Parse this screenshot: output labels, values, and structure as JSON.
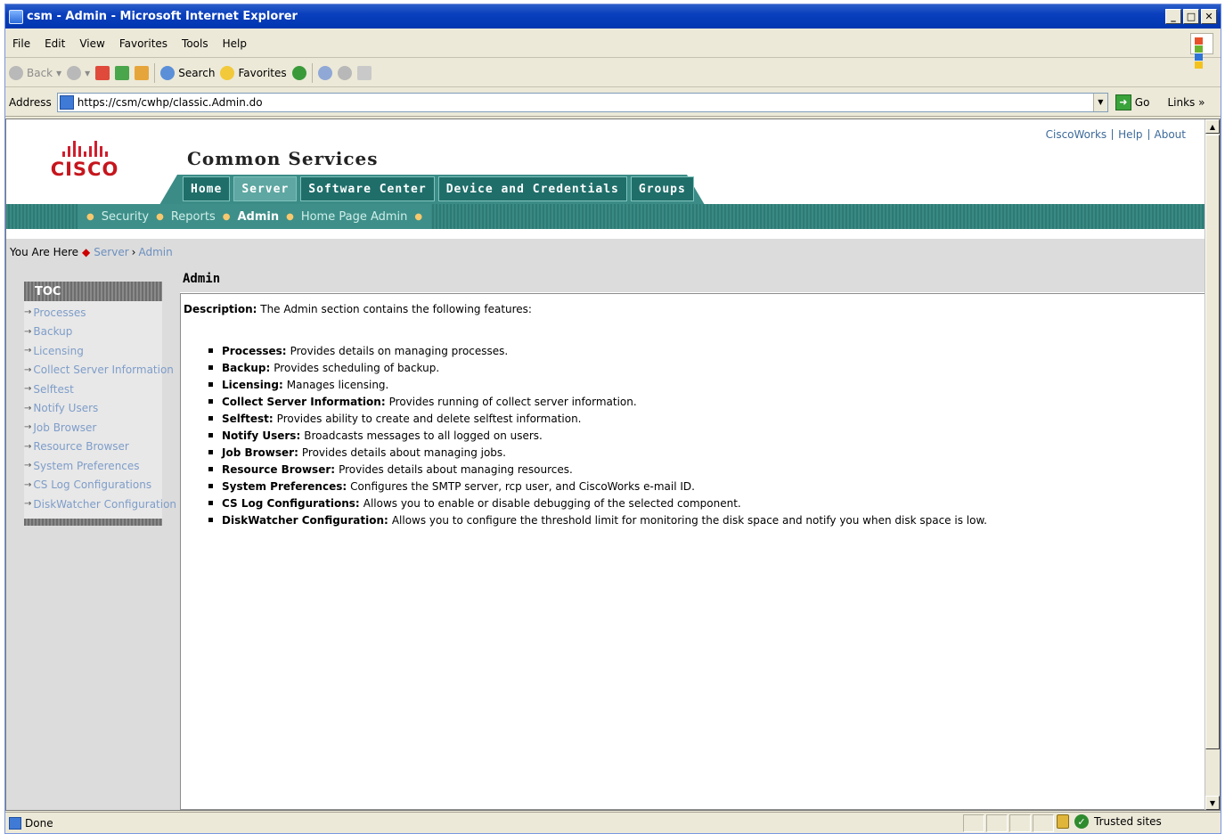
{
  "window": {
    "title": "csm - Admin - Microsoft Internet Explorer"
  },
  "menu": [
    "File",
    "Edit",
    "View",
    "Favorites",
    "Tools",
    "Help"
  ],
  "toolbar": {
    "back": "Back",
    "search": "Search",
    "favorites": "Favorites"
  },
  "address": {
    "label": "Address",
    "url": "https://csm/cwhp/classic.Admin.do",
    "go": "Go",
    "links": "Links"
  },
  "header": {
    "brand": "CISCO",
    "site_title": "Common Services",
    "top_links": [
      "CiscoWorks",
      "Help",
      "About"
    ],
    "tabs": [
      "Home",
      "Server",
      "Software Center",
      "Device and Credentials",
      "Groups"
    ],
    "active_tab": "Server",
    "subnav": [
      "Security",
      "Reports",
      "Admin",
      "Home Page Admin"
    ],
    "active_subnav": "Admin"
  },
  "breadcrumb": {
    "prefix": "You Are Here",
    "items": [
      "Server",
      "Admin"
    ]
  },
  "toc": {
    "title": "TOC",
    "items": [
      "Processes",
      "Backup",
      "Licensing",
      "Collect Server Information",
      "Selftest",
      "Notify Users",
      "Job Browser",
      "Resource Browser",
      "System Preferences",
      "CS Log Configurations",
      "DiskWatcher Configuration"
    ]
  },
  "main": {
    "title": "Admin",
    "description_label": "Description:",
    "description_text": "The Admin section contains the following features:",
    "features": [
      {
        "name": "Processes:",
        "text": "Provides details on managing processes."
      },
      {
        "name": "Backup:",
        "text": "Provides scheduling of backup."
      },
      {
        "name": "Licensing:",
        "text": "Manages licensing."
      },
      {
        "name": "Collect Server Information:",
        "text": "Provides running of collect server information."
      },
      {
        "name": "Selftest:",
        "text": "Provides ability to create and delete selftest information."
      },
      {
        "name": "Notify Users:",
        "text": "Broadcasts messages to all logged on users."
      },
      {
        "name": "Job Browser:",
        "text": "Provides details about managing jobs."
      },
      {
        "name": "Resource Browser:",
        "text": "Provides details about managing resources."
      },
      {
        "name": "System Preferences:",
        "text": "Configures the SMTP server, rcp user, and CiscoWorks e-mail ID."
      },
      {
        "name": "CS Log Configurations:",
        "text": "Allows you to enable or disable debugging of the selected component."
      },
      {
        "name": "DiskWatcher Configuration:",
        "text": "Allows you to configure the threshold limit for monitoring the disk space and notify you when disk space is low."
      }
    ]
  },
  "status": {
    "left": "Done",
    "zone": "Trusted sites"
  },
  "colors": {
    "teal_nav": "#3b8c86",
    "tab_dark": "#1f6e6a",
    "cisco_red": "#c6151d",
    "link_blue": "#7e9dc9",
    "title_bar": "#0a3fbd"
  }
}
